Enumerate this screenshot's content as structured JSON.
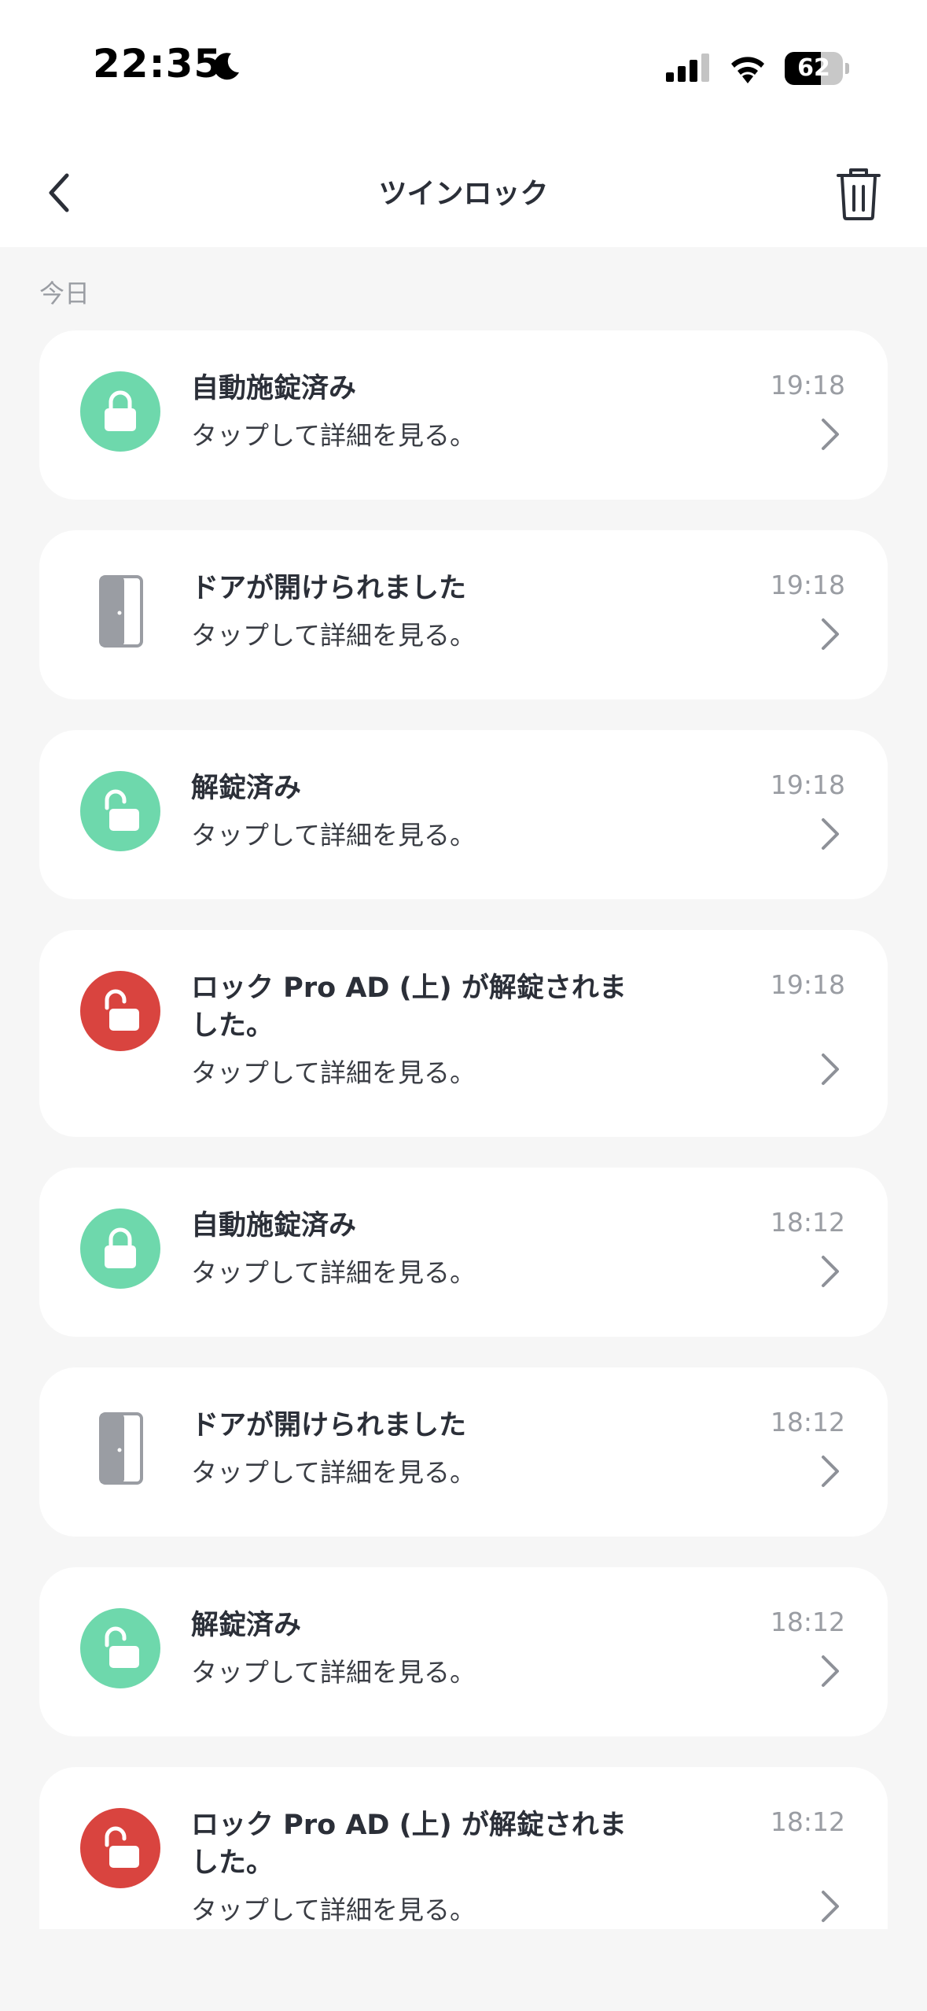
{
  "status_bar": {
    "time": "22:35",
    "battery_percent": 62,
    "battery_label": "62",
    "icons": [
      "moon-icon",
      "signal-icon",
      "wifi-icon",
      "battery-icon"
    ]
  },
  "header": {
    "title": "ツインロック",
    "back_icon": "chevron-left-icon",
    "trash_icon": "trash-icon"
  },
  "section": {
    "label": "今日"
  },
  "colors": {
    "green": "#6ed8ac",
    "red": "#d9443f",
    "door_gray": "#9a9da3",
    "background": "#f6f6f6",
    "card": "#ffffff"
  },
  "events": [
    {
      "icon": "lock-closed-icon",
      "tone": "green",
      "title": "自動施錠済み",
      "subtitle": "タップして詳細を見る。",
      "time": "19:18"
    },
    {
      "icon": "door-open-icon",
      "tone": "gray",
      "title": "ドアが開けられました",
      "subtitle": "タップして詳細を見る。",
      "time": "19:18"
    },
    {
      "icon": "lock-open-icon",
      "tone": "green",
      "title": "解錠済み",
      "subtitle": "タップして詳細を見る。",
      "time": "19:18"
    },
    {
      "icon": "lock-open-icon",
      "tone": "red",
      "title": "ロック Pro AD (上) が解錠されました。",
      "subtitle": "タップして詳細を見る。",
      "time": "19:18"
    },
    {
      "icon": "lock-closed-icon",
      "tone": "green",
      "title": "自動施錠済み",
      "subtitle": "タップして詳細を見る。",
      "time": "18:12"
    },
    {
      "icon": "door-open-icon",
      "tone": "gray",
      "title": "ドアが開けられました",
      "subtitle": "タップして詳細を見る。",
      "time": "18:12"
    },
    {
      "icon": "lock-open-icon",
      "tone": "green",
      "title": "解錠済み",
      "subtitle": "タップして詳細を見る。",
      "time": "18:12"
    },
    {
      "icon": "lock-open-icon",
      "tone": "red",
      "title": "ロック Pro AD (上) が解錠されました。",
      "subtitle": "タップして詳細を見る。",
      "time": "18:12"
    }
  ]
}
